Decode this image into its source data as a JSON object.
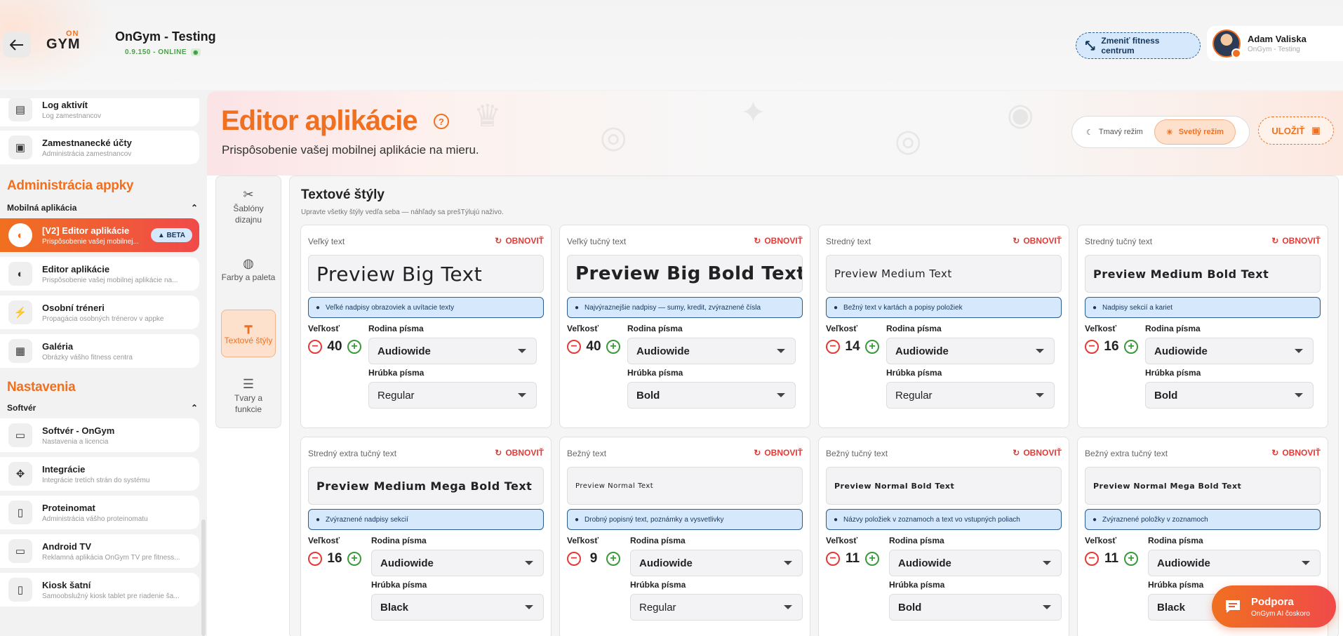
{
  "header": {
    "logo_top": "ON",
    "logo_bottom": "GYM",
    "app_title": "OnGym - Testing",
    "version": "0.9.150 - ONLINE",
    "center_button": "Zmeniť fitness centrum",
    "user_name": "Adam Valiska",
    "user_sub": "OnGym - Testing"
  },
  "sidebar": {
    "items_top": [
      {
        "label": "Log aktivít",
        "sub": "Log zamestnancov",
        "icon": "clipboard-icon"
      },
      {
        "label": "Zamestnanecké účty",
        "sub": "Administrácia zamestnancov",
        "icon": "id-badge-icon"
      }
    ],
    "section_admin": "Administrácia appky",
    "group_mobile": "Mobilná aplikácia",
    "items_mobile": [
      {
        "label": "[V2] Editor aplikácie",
        "sub": "Prispôsobenie vašej mobilnej...",
        "badge": "BETA",
        "icon": "half-circle-icon"
      },
      {
        "label": "Editor aplikácie",
        "sub": "Prispôsobenie vašej mobilnej aplikácie na...",
        "icon": "half-circle-icon"
      },
      {
        "label": "Osobní tréneri",
        "sub": "Propagácia osobných trénerov v appke",
        "icon": "runner-icon"
      },
      {
        "label": "Galéria",
        "sub": "Obrázky vášho fitness centra",
        "icon": "image-icon"
      }
    ],
    "section_settings": "Nastavenia",
    "group_software": "Softvér",
    "items_software": [
      {
        "label": "Softvér - OnGym",
        "sub": "Nastavenia a licencia",
        "icon": "terminal-icon"
      },
      {
        "label": "Integrácie",
        "sub": "Integrácie tretích strán do systému",
        "icon": "integrations-icon"
      },
      {
        "label": "Proteinomat",
        "sub": "Administrácia vášho proteinomatu",
        "icon": "vending-icon"
      },
      {
        "label": "Android TV",
        "sub": "Reklamná aplikácia OnGym TV pre fitness...",
        "icon": "tv-icon"
      },
      {
        "label": "Kiosk šatní",
        "sub": "Samoobslužný kiosk tablet pre riadenie ša...",
        "icon": "tablet-icon"
      }
    ]
  },
  "page": {
    "title": "Editor aplikácie",
    "subtitle": "Prispôsobenie vašej mobilnej aplikácie na mieru.",
    "theme_dark": "Tmavý režim",
    "theme_light": "Svetlý režim",
    "save": "ULOŽIŤ"
  },
  "tools": [
    {
      "label": "Šablóny dizajnu",
      "icon": "tools-icon"
    },
    {
      "label": "Farby a paleta",
      "icon": "palette-icon"
    },
    {
      "label": "Textové štýly",
      "icon": "paint-roller-icon",
      "active": true
    },
    {
      "label": "Tvary a funkcie",
      "icon": "sliders-icon"
    }
  ],
  "section": {
    "title": "Textové štýly",
    "subtitle": "Upravte všetky štýly vedľa seba — náhľady sa prešTýlujú naživo."
  },
  "labels": {
    "reset": "OBNOVIŤ",
    "size": "Veľkosť",
    "family": "Rodina písma",
    "weight": "Hrúbka písma"
  },
  "styles": [
    {
      "name": "Veľký text",
      "preview": "Preview Big Text",
      "hint": "Veľké nadpisy obrazoviek a uvítacie texty",
      "size": "40",
      "family": "Audiowide",
      "weight": "Regular"
    },
    {
      "name": "Veľký tučný text",
      "preview": "Preview Big Bold Text",
      "hint": "Najvýraznejšie nadpisy — sumy, kredit, zvýraznené čísla",
      "size": "40",
      "family": "Audiowide",
      "weight": "Bold"
    },
    {
      "name": "Stredný text",
      "preview": "Preview Medium Text",
      "hint": "Bežný text v kartách a popisy položiek",
      "size": "14",
      "family": "Audiowide",
      "weight": "Regular"
    },
    {
      "name": "Stredný tučný text",
      "preview": "Preview Medium Bold Text",
      "hint": "Nadpisy sekcií a kariet",
      "size": "16",
      "family": "Audiowide",
      "weight": "Bold"
    },
    {
      "name": "Stredný extra tučný text",
      "preview": "Preview Medium Mega Bold Text",
      "hint": "Zvýraznené nadpisy sekcií",
      "size": "16",
      "family": "Audiowide",
      "weight": "Black"
    },
    {
      "name": "Bežný text",
      "preview": "Preview Normal Text",
      "hint": "Drobný popisný text, poznámky a vysvetlivky",
      "size": "9",
      "family": "Audiowide",
      "weight": "Regular"
    },
    {
      "name": "Bežný tučný text",
      "preview": "Preview Normal Bold Text",
      "hint": "Názvy položiek v zoznamoch a text vo vstupných poliach",
      "size": "11",
      "family": "Audiowide",
      "weight": "Bold"
    },
    {
      "name": "Bežný extra tučný text",
      "preview": "Preview Normal Mega Bold Text",
      "hint": "Zvýraznené položky v zoznamoch",
      "size": "11",
      "family": "Audiowide",
      "weight": "Black"
    }
  ],
  "support": {
    "title": "Podpora",
    "sub": "OnGym AI čoskoro"
  },
  "colors": {
    "accent": "#f07020",
    "accent_red": "#f04a4a",
    "info_bg": "#d6e8fb",
    "info_border": "#2a5c8f",
    "reset_red": "#e53935",
    "plus_green": "#3a9a3a"
  }
}
